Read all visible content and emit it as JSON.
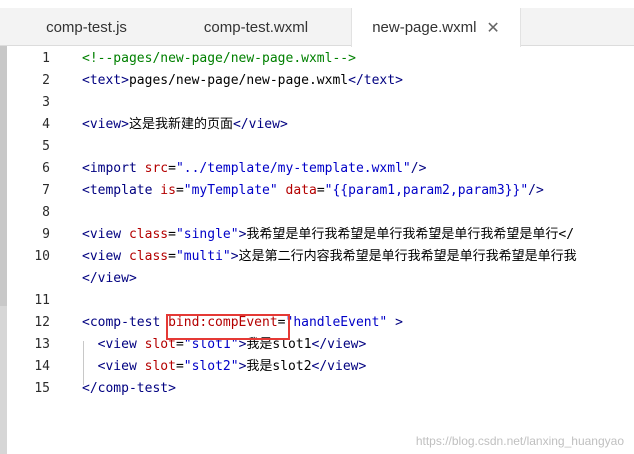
{
  "tabs": [
    {
      "label": "comp-test.js"
    },
    {
      "label": "comp-test.wxml"
    },
    {
      "label": "new-page.wxml",
      "close": "✕"
    }
  ],
  "lines": [
    {
      "n": "1",
      "parts": [
        {
          "c": "com",
          "t": "<!--pages/new-page/new-page.wxml-->"
        }
      ]
    },
    {
      "n": "2",
      "parts": [
        {
          "c": "tag",
          "t": "<text>"
        },
        {
          "c": "txt",
          "t": "pages/new-page/new-page.wxml"
        },
        {
          "c": "tag",
          "t": "</text>"
        }
      ]
    },
    {
      "n": "3",
      "parts": []
    },
    {
      "n": "4",
      "parts": [
        {
          "c": "tag",
          "t": "<view>"
        },
        {
          "c": "txt",
          "t": "这是我新建的页面"
        },
        {
          "c": "tag",
          "t": "</view>"
        }
      ]
    },
    {
      "n": "5",
      "parts": []
    },
    {
      "n": "6",
      "parts": [
        {
          "c": "tag",
          "t": "<import "
        },
        {
          "c": "attr",
          "t": "src"
        },
        {
          "c": "txt",
          "t": "="
        },
        {
          "c": "str",
          "t": "\"../template/my-template.wxml\""
        },
        {
          "c": "tag",
          "t": "/>"
        }
      ]
    },
    {
      "n": "7",
      "parts": [
        {
          "c": "tag",
          "t": "<template "
        },
        {
          "c": "attr",
          "t": "is"
        },
        {
          "c": "txt",
          "t": "="
        },
        {
          "c": "str",
          "t": "\"myTemplate\""
        },
        {
          "c": "tag",
          "t": " "
        },
        {
          "c": "attr",
          "t": "data"
        },
        {
          "c": "txt",
          "t": "="
        },
        {
          "c": "str",
          "t": "\"{{param1,param2,param3}}\""
        },
        {
          "c": "tag",
          "t": "/>"
        }
      ]
    },
    {
      "n": "8",
      "parts": []
    },
    {
      "n": "9",
      "parts": [
        {
          "c": "tag",
          "t": "<view "
        },
        {
          "c": "attr",
          "t": "class"
        },
        {
          "c": "txt",
          "t": "="
        },
        {
          "c": "str",
          "t": "\"single\""
        },
        {
          "c": "tag",
          "t": ">"
        },
        {
          "c": "txt",
          "t": "我希望是单行我希望是单行我希望是单行我希望是单行</"
        }
      ]
    },
    {
      "n": "10",
      "parts": [
        {
          "c": "tag",
          "t": "<view "
        },
        {
          "c": "attr",
          "t": "class"
        },
        {
          "c": "txt",
          "t": "="
        },
        {
          "c": "str",
          "t": "\"multi\""
        },
        {
          "c": "tag",
          "t": ">"
        },
        {
          "c": "txt",
          "t": "这是第二行内容我希望是单行我希望是单行我希望是单行我"
        }
      ]
    },
    {
      "n": "",
      "parts": [
        {
          "c": "tag",
          "t": "</view>"
        }
      ]
    },
    {
      "n": "11",
      "parts": []
    },
    {
      "n": "12",
      "parts": [
        {
          "c": "tag",
          "t": "<comp-test "
        },
        {
          "c": "attr",
          "t": "bind:compEvent"
        },
        {
          "c": "txt",
          "t": "="
        },
        {
          "c": "str",
          "t": "\"handleEvent\""
        },
        {
          "c": "tag",
          "t": " >"
        }
      ]
    },
    {
      "n": "13",
      "parts": [
        {
          "c": "tag",
          "t": "  <view "
        },
        {
          "c": "attr",
          "t": "slot"
        },
        {
          "c": "txt",
          "t": "="
        },
        {
          "c": "str",
          "t": "\"slot1\""
        },
        {
          "c": "tag",
          "t": ">"
        },
        {
          "c": "txt",
          "t": "我是slot1"
        },
        {
          "c": "tag",
          "t": "</view>"
        }
      ]
    },
    {
      "n": "14",
      "parts": [
        {
          "c": "tag",
          "t": "  <view "
        },
        {
          "c": "attr",
          "t": "slot"
        },
        {
          "c": "txt",
          "t": "="
        },
        {
          "c": "str",
          "t": "\"slot2\""
        },
        {
          "c": "tag",
          "t": ">"
        },
        {
          "c": "txt",
          "t": "我是slot2"
        },
        {
          "c": "tag",
          "t": "</view>"
        }
      ]
    },
    {
      "n": "15",
      "parts": [
        {
          "c": "tag",
          "t": "</comp-test>"
        }
      ]
    }
  ],
  "watermark": "https://blog.csdn.net/lanxing_huangyao",
  "colors": {
    "tag": "#000080",
    "attr": "#b40000",
    "string": "#0000c8",
    "comment": "#008000",
    "highlight": "#e53935"
  }
}
